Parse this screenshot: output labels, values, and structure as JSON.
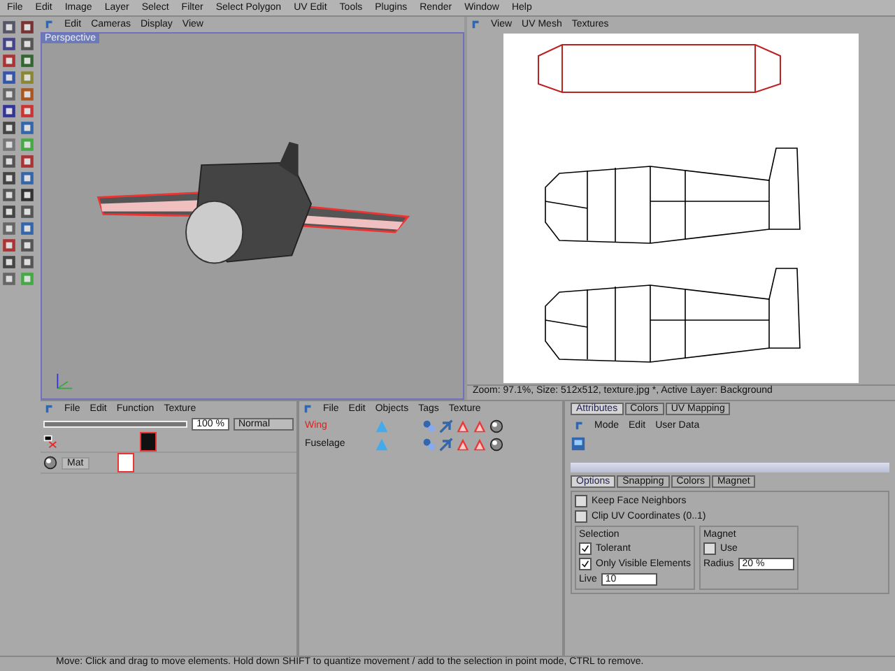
{
  "menu_bar": [
    "File",
    "Edit",
    "Image",
    "Layer",
    "Select",
    "Filter",
    "Select Polygon",
    "UV Edit",
    "Tools",
    "Plugins",
    "Render",
    "Window",
    "Help"
  ],
  "viewport": {
    "menu": [
      "Edit",
      "Cameras",
      "Display",
      "View"
    ],
    "label": "Perspective"
  },
  "uv_editor": {
    "menu": [
      "View",
      "UV Mesh",
      "Textures"
    ],
    "status": "Zoom: 97.1%, Size: 512x512, texture.jpg *, Active Layer: Background"
  },
  "material_manager": {
    "menu": [
      "File",
      "Edit",
      "Function",
      "Texture"
    ],
    "opacity_slider": {
      "level": 1
    },
    "opacity": "100 %",
    "blend_mode": "Normal",
    "materials": [
      {
        "name": "Mat"
      }
    ]
  },
  "object_manager": {
    "menu": [
      "File",
      "Edit",
      "Objects",
      "Tags",
      "Texture"
    ],
    "objects": [
      {
        "name": "Wing",
        "selected": true
      },
      {
        "name": "Fuselage",
        "selected": false
      }
    ]
  },
  "attributes": {
    "top_tabs": [
      {
        "label": "Attributes",
        "selected": true
      },
      {
        "label": "Colors",
        "selected": false
      },
      {
        "label": "UV Mapping",
        "selected": false
      }
    ],
    "menu": [
      "Mode",
      "Edit",
      "User Data"
    ],
    "tabs": [
      {
        "label": "Options",
        "selected": true
      },
      {
        "label": "Snapping",
        "selected": false
      },
      {
        "label": "Colors",
        "selected": false
      },
      {
        "label": "Magnet",
        "selected": false
      }
    ],
    "checkboxes": [
      {
        "label": "Keep Face Neighbors",
        "checked": false
      },
      {
        "label": "Clip UV Coordinates (0..1)",
        "checked": false
      }
    ],
    "selection": {
      "title": "Selection",
      "options": [
        {
          "label": "Tolerant",
          "checked": true
        },
        {
          "label": "Only Visible Elements",
          "checked": true
        }
      ],
      "live_label": "Live",
      "live_value": "10"
    },
    "magnet": {
      "title": "Magnet",
      "use": {
        "label": "Use",
        "checked": false
      },
      "radius_label": "Radius",
      "radius_value": "20 %"
    }
  },
  "status_bar": "Move: Click and drag to move elements. Hold down SHIFT to quantize movement / add to the selection in point mode, CTRL to remove."
}
